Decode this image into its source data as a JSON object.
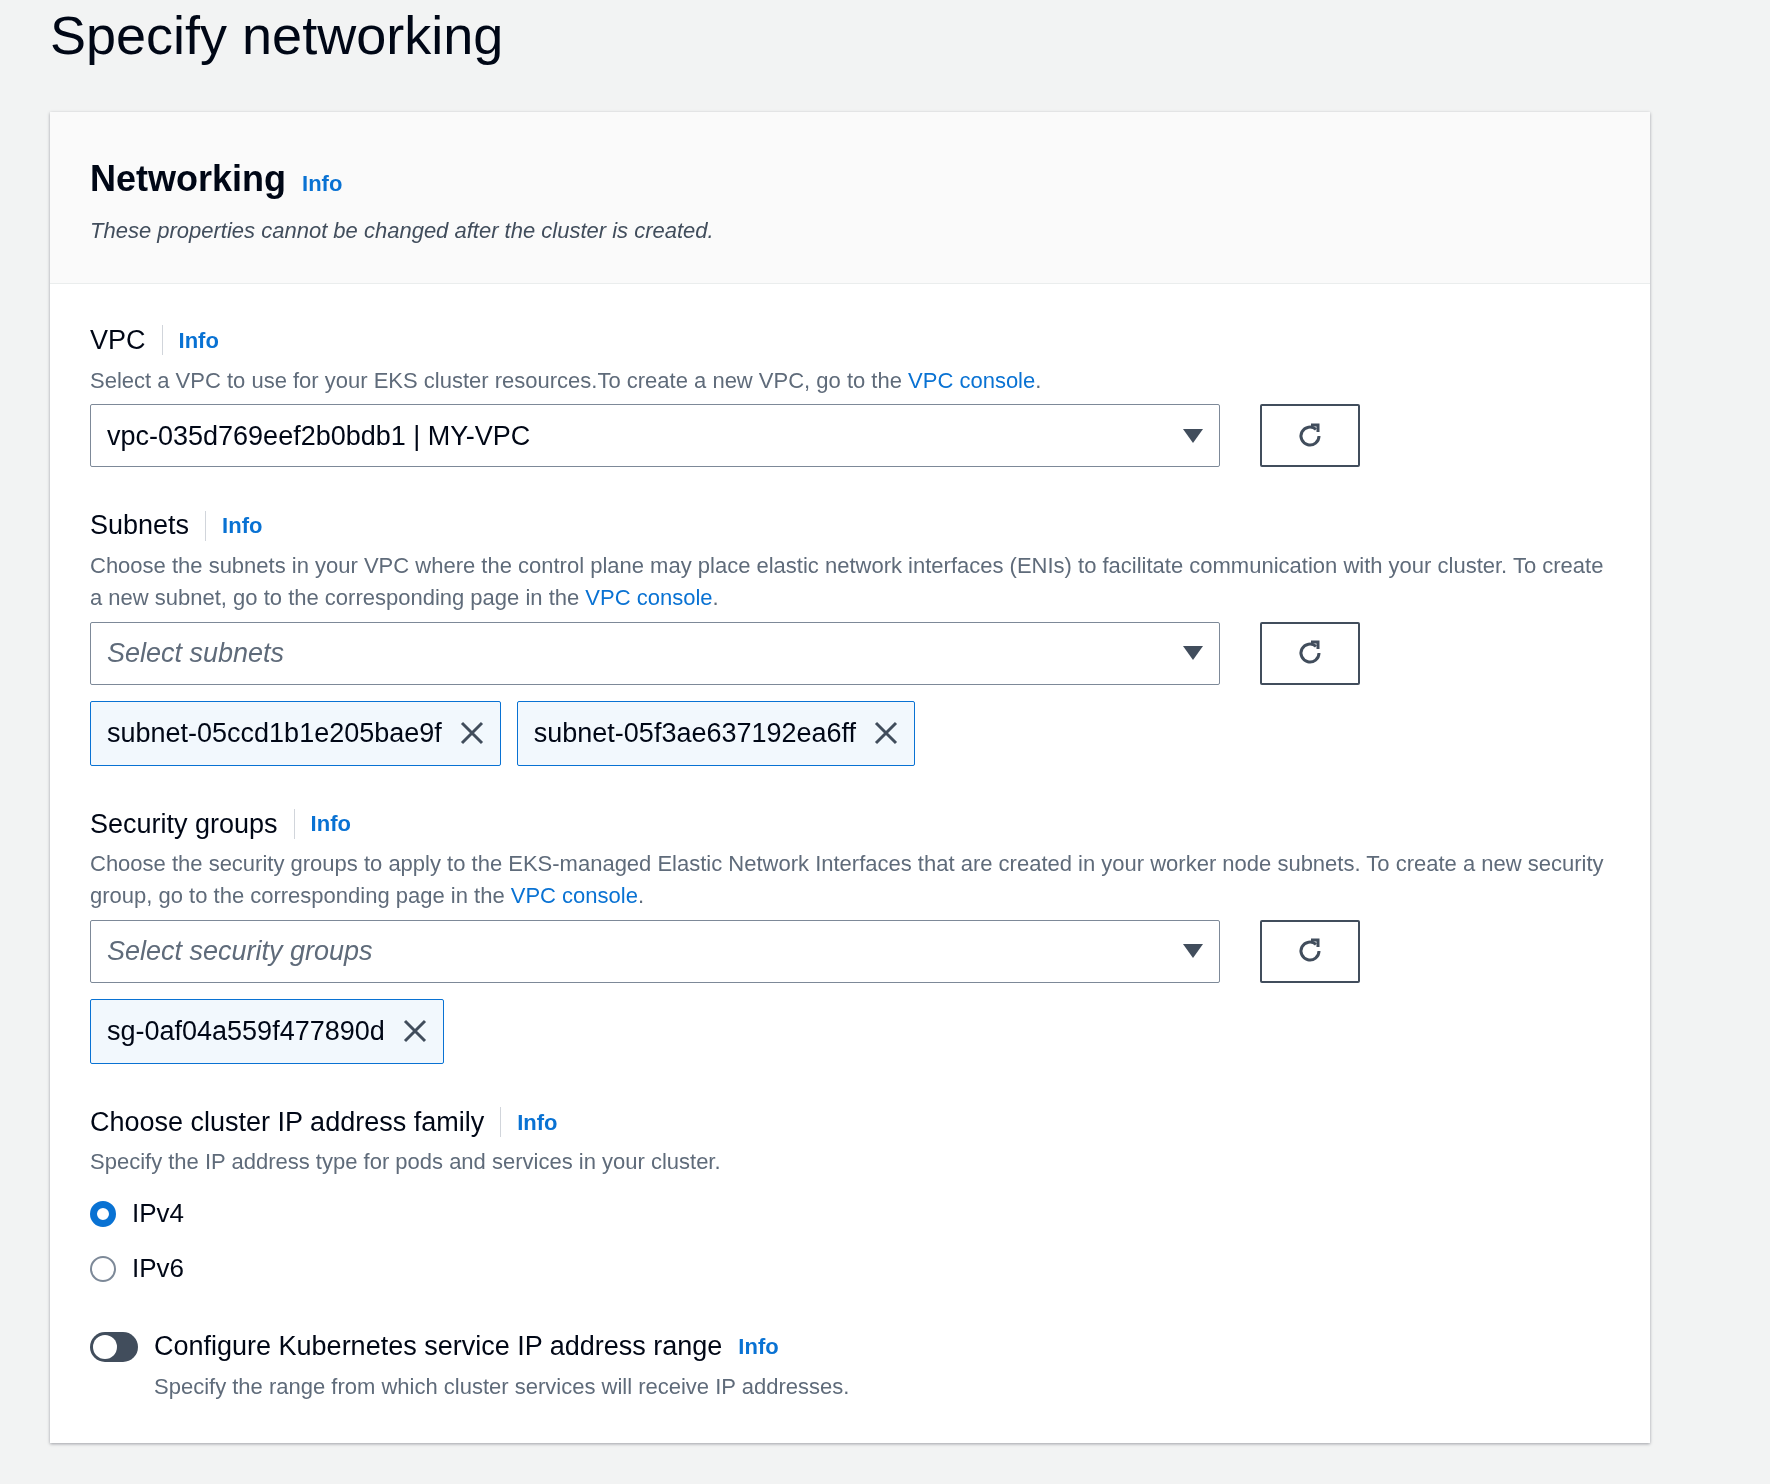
{
  "page_title": "Specify networking",
  "panel": {
    "title": "Networking",
    "info": "Info",
    "description": "These properties cannot be changed after the cluster is created."
  },
  "fields": [
    {
      "kind": "select",
      "label": "VPC",
      "info": "Info",
      "description": "Select a VPC to use for your EKS cluster resources.To create a new VPC, go to the ",
      "link": "VPC console",
      "description_end": ".",
      "value": "vpc-035d769eef2b0bdb1 | MY-VPC"
    },
    {
      "kind": "select",
      "label": "Subnets",
      "info": "Info",
      "description": "Choose the subnets in your VPC where the control plane may place elastic network interfaces (ENIs) to facilitate communication with your cluster. To create a new subnet, go to the corresponding page in the ",
      "link": "VPC console",
      "description_end": ".",
      "placeholder": "Select subnets",
      "tokens": [
        "subnet-05ccd1b1e205bae9f",
        "subnet-05f3ae637192ea6ff"
      ]
    },
    {
      "kind": "select",
      "label": "Security groups",
      "info": "Info",
      "description": "Choose the security groups to apply to the EKS-managed Elastic Network Interfaces that are created in your worker node subnets. To create a new security group, go to the corresponding page in the ",
      "link": "VPC console",
      "description_end": ".",
      "placeholder": "Select security groups",
      "tokens": [
        "sg-0af04a559f477890d"
      ]
    },
    {
      "kind": "radio",
      "label": "Choose cluster IP address family",
      "info": "Info",
      "description": "Specify the IP address type for pods and services in your cluster.",
      "options": [
        {
          "label": "IPv4",
          "selected": true
        },
        {
          "label": "IPv6",
          "selected": false
        }
      ]
    },
    {
      "kind": "toggle",
      "label": "Configure Kubernetes service IP address range",
      "info": "Info",
      "description": "Specify the range from which cluster services will receive IP addresses.",
      "on": false
    }
  ]
}
